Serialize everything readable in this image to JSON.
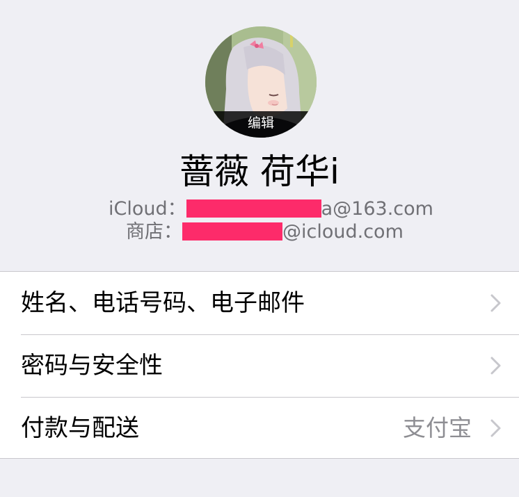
{
  "profile": {
    "avatar_edit_label": "编辑",
    "name": "蔷薇 荷华i",
    "icloud_label": "iCloud：",
    "icloud_email_suffix": "a@163.com",
    "store_label": "商店：",
    "store_email_suffix": "@icloud.com",
    "redaction_color": "#fd2b6a"
  },
  "settings": {
    "rows": [
      {
        "label": "姓名、电话号码、电子邮件",
        "value": "",
        "icon": "chevron-right-icon"
      },
      {
        "label": "密码与安全性",
        "value": "",
        "icon": "chevron-right-icon"
      },
      {
        "label": "付款与配送",
        "value": "支付宝",
        "icon": "chevron-right-icon"
      }
    ]
  },
  "colors": {
    "background": "#efeff4",
    "cell_background": "#ffffff",
    "separator": "#c8c7cc",
    "secondary_text": "#8e8e93"
  }
}
